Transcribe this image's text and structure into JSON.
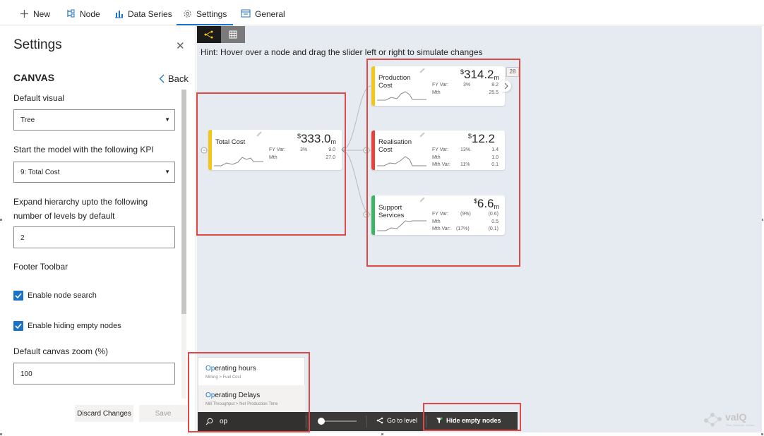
{
  "nav": {
    "tabs": [
      {
        "label": "New"
      },
      {
        "label": "Node"
      },
      {
        "label": "Data Series"
      },
      {
        "label": "Settings"
      },
      {
        "label": "General"
      }
    ]
  },
  "settings": {
    "title": "Settings",
    "section": "CANVAS",
    "back_label": "Back",
    "default_visual_label": "Default visual",
    "default_visual_value": "Tree",
    "start_kpi_label": "Start the model with the following KPI",
    "start_kpi_value": "9: Total Cost",
    "expand_label": "Expand hierarchy upto the following number of levels by default",
    "expand_value": "2",
    "footer_toolbar_label": "Footer Toolbar",
    "enable_search_label": "Enable node search",
    "enable_hiding_label": "Enable hiding empty nodes",
    "zoom_label": "Default canvas zoom (%)",
    "zoom_value": "100",
    "discard_label": "Discard Changes",
    "save_label": "Save"
  },
  "canvas": {
    "hint": "Hint: Hover over a node and drag the slider left or right to simulate changes",
    "badge": "28",
    "nodes": [
      {
        "name": "Total Cost",
        "currency": "$",
        "value": "333.0",
        "unit": "m",
        "color": "#f5c518",
        "metrics": [
          {
            "label": "FY Var:",
            "pct": "3%",
            "val": "9.0"
          },
          {
            "label": "Mth",
            "pct": "",
            "val": "27.0"
          }
        ]
      },
      {
        "name": "Production Cost",
        "currency": "$",
        "value": "314.2",
        "unit": "m",
        "color": "#f5c518",
        "metrics": [
          {
            "label": "FY Var:",
            "pct": "3%",
            "val": "8.2"
          },
          {
            "label": "Mth",
            "pct": "",
            "val": "25.5"
          }
        ]
      },
      {
        "name": "Realisation Cost",
        "currency": "$",
        "value": "12.2",
        "unit": "",
        "color": "#e8413c",
        "metrics": [
          {
            "label": "FY Var:",
            "pct": "13%",
            "val": "1.4"
          },
          {
            "label": "Mth",
            "pct": "",
            "val": "1.0"
          },
          {
            "label": "Mth Var:",
            "pct": "11%",
            "val": "0.1"
          }
        ]
      },
      {
        "name": "Support Services",
        "currency": "$",
        "value": "6.6",
        "unit": "m",
        "color": "#3cb563",
        "metrics": [
          {
            "label": "FY Var:",
            "pct": "(9%)",
            "val": "(0.6)"
          },
          {
            "label": "Mth",
            "pct": "",
            "val": "0.5"
          },
          {
            "label": "Mth Var:",
            "pct": "(17%)",
            "val": "(0.1)"
          }
        ]
      }
    ]
  },
  "search": {
    "query": "op",
    "suggestions": [
      {
        "match": "Op",
        "rest": "erating hours",
        "path": "Mining > Fuel Cost"
      },
      {
        "match": "Op",
        "rest": "erating Delays",
        "path": "Mill Throughput > Net Production Time"
      }
    ]
  },
  "footer": {
    "goto_label": "Go to level",
    "hide_label": "Hide empty nodes"
  },
  "brand": {
    "logo": "valQ",
    "tagline": "Plan. Simulate. Decide."
  },
  "colors": {
    "accent": "#1a73c6",
    "highlight": "#e04a46",
    "footer_bg": "#3b3a39",
    "canvas_bg": "#e6eaf1"
  }
}
